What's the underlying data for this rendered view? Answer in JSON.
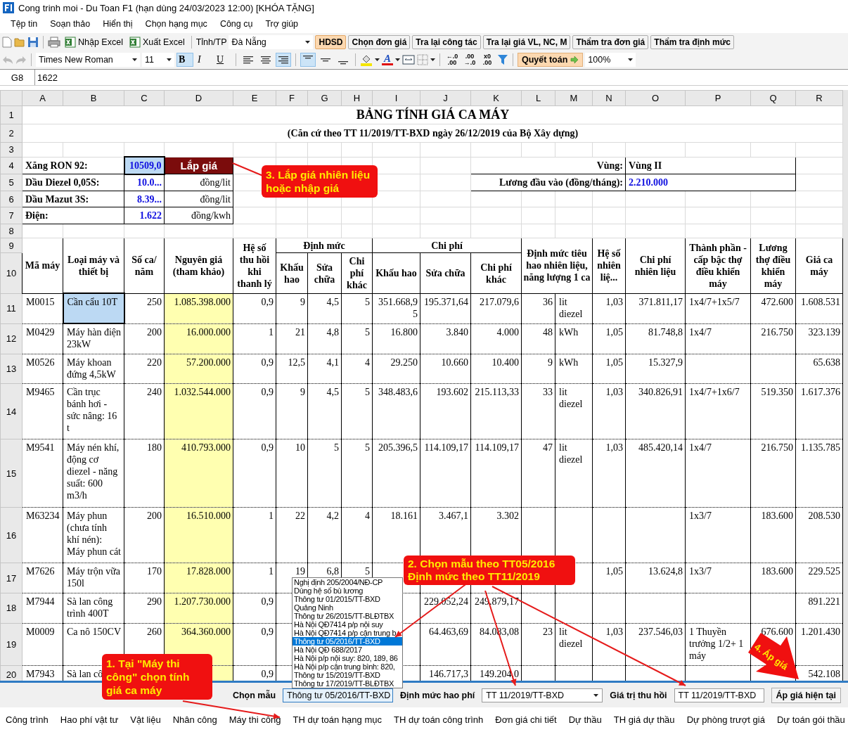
{
  "window": {
    "title": "Cong trinh moi - Du Toan F1  (hạn dùng 24/03/2023 12:00) [KHÓA TẶNG]"
  },
  "menu": [
    "Tệp tin",
    "Soạn thảo",
    "Hiển thị",
    "Chọn hạng mục",
    "Công cụ",
    "Trợ giúp"
  ],
  "toolbar": {
    "import_excel": "Nhập Excel",
    "export_excel": "Xuất Excel",
    "province_label": "Tỉnh/TP",
    "province": "Đà Nẵng",
    "buttons": [
      {
        "label": "HDSD",
        "highlighted": true
      },
      {
        "label": "Chọn đơn giá",
        "highlighted": false
      },
      {
        "label": "Tra lại công tác",
        "highlighted": false
      },
      {
        "label": "Tra lại giá VL, NC, M",
        "highlighted": false
      },
      {
        "label": "Thẩm tra đơn giá",
        "highlighted": false
      },
      {
        "label": "Thẩm tra định mức",
        "highlighted": false
      }
    ]
  },
  "format_bar": {
    "font": "Times New Roman",
    "size": "11",
    "styles": [
      {
        "glyph": "B",
        "selected": true
      },
      {
        "glyph": "I",
        "selected": false
      },
      {
        "glyph": "U",
        "selected": false
      }
    ],
    "halign": [
      {
        "kind": "left",
        "selected": false
      },
      {
        "kind": "center",
        "selected": false
      },
      {
        "kind": "right",
        "selected": true
      }
    ],
    "valign": [
      {
        "kind": "top",
        "selected": true
      },
      {
        "kind": "middle",
        "selected": false
      },
      {
        "kind": "bottom",
        "selected": false
      }
    ],
    "font_color_glyph": "A",
    "decimals": [
      {
        "top": "←.0",
        "bottom": ".00"
      },
      {
        "top": ".00",
        "bottom": "→.0"
      },
      {
        "top": "x0",
        "bottom": ".00"
      }
    ],
    "settle_button": "Quyết toán",
    "zoom": "100%"
  },
  "formula_bar": {
    "cell": "G8",
    "value": "1622"
  },
  "sheet": {
    "columns": [
      "A",
      "B",
      "C",
      "D",
      "E",
      "F",
      "G",
      "H",
      "I",
      "J",
      "K",
      "L",
      "M",
      "N",
      "O",
      "P",
      "Q",
      "R"
    ],
    "rows": [
      {
        "kind": "title",
        "number": "1",
        "text": "BẢNG TÍNH GIÁ CA MÁY"
      },
      {
        "kind": "subtitle",
        "number": "2",
        "text": "(Căn cứ theo TT 11/2019/TT-BXD ngày 26/12/2019 của Bộ Xây dựng)"
      },
      {
        "kind": "blank",
        "number": "3"
      },
      {
        "kind": "params",
        "number": "4",
        "label": "Xăng RON 92:",
        "value": {
          "text": "10509,0",
          "selected": true
        },
        "button": "Lắp giá",
        "right_label": "Vùng:",
        "right_value": {
          "text": "Vùng II",
          "kind": "text"
        }
      },
      {
        "kind": "params",
        "number": "5",
        "label": "Dầu Diezel 0,05S:",
        "value": {
          "text": "10.0...",
          "selected": false
        },
        "unit": "đồng/lit",
        "right_label": "Lương đầu vào (đồng/tháng):",
        "right_value": {
          "text": "2.210.000",
          "kind": "number"
        }
      },
      {
        "kind": "params",
        "number": "6",
        "label": "Dầu Mazut 3S:",
        "value": {
          "text": "8.39...",
          "selected": false
        },
        "unit": "đồng/lit"
      },
      {
        "kind": "params",
        "number": "7",
        "label": "Điện:",
        "value": {
          "text": "1.622",
          "selected": false
        },
        "unit": "đồng/kwh"
      },
      {
        "kind": "blank",
        "number": "8"
      },
      {
        "kind": "header",
        "numbers": [
          "9",
          "10"
        ],
        "columns": [
          {
            "text": "Mã máy"
          },
          {
            "text": "Loại máy và thiết bị"
          },
          {
            "text": "Số ca/ năm"
          },
          {
            "text": "Nguyên giá (tham khảo)"
          },
          {
            "text": "Hệ số thu hồi khi thanh lý"
          },
          {
            "text": "Định mức",
            "children": [
              "Khấu hao",
              "Sửa chữa",
              "Chi phí khác"
            ]
          },
          {
            "text": "Chi phí",
            "children": [
              "Khấu hao",
              "Sửa chữa",
              "Chi phí khác"
            ]
          },
          {
            "text": "Định mức tiêu hao nhiên liệu, năng lượng 1 ca",
            "wide": true
          },
          {
            "text": "Hệ số nhiên liệ..."
          },
          {
            "text": "Chi phí nhiên liệu"
          },
          {
            "text": "Thành phần - cấp bậc thợ điều khiển máy"
          },
          {
            "text": "Lương thợ điều khiển máy"
          },
          {
            "text": "Giá ca máy"
          }
        ]
      },
      {
        "kind": "data",
        "number": "11",
        "cells": [
          "M0015",
          {
            "text": "Cần cẩu 10T",
            "selected": true
          },
          "250",
          "1.085.398.000",
          "0,9",
          "9",
          "4,5",
          "5",
          "351.668,95",
          "195.371,64",
          "217.079,6",
          "36",
          "lit diezel",
          "1,03",
          "371.811,17",
          "1x4/7+1x5/7",
          "472.600",
          "1.608.531"
        ]
      },
      {
        "kind": "data",
        "number": "12",
        "cells": [
          "M0429",
          "Máy hàn điện 23kW",
          "200",
          "16.000.000",
          "1",
          "21",
          "4,8",
          "5",
          "16.800",
          "3.840",
          "4.000",
          "48",
          "kWh",
          "1,05",
          "81.748,8",
          "1x4/7",
          "216.750",
          "323.139"
        ]
      },
      {
        "kind": "data",
        "number": "13",
        "cells": [
          "M0526",
          "Máy khoan đứng 4,5kW",
          "220",
          "57.200.000",
          "0,9",
          "12,5",
          "4,1",
          "4",
          "29.250",
          "10.660",
          "10.400",
          "9",
          "kWh",
          "1,05",
          "15.327,9",
          null,
          null,
          "65.638"
        ]
      },
      {
        "kind": "data",
        "number": "14",
        "cells": [
          "M9465",
          "Cần trục bánh hơi - sức nâng: 16 t",
          "240",
          "1.032.544.000",
          "0,9",
          "9",
          "4,5",
          "5",
          "348.483,6",
          "193.602",
          "215.113,33",
          "33",
          "lit diezel",
          "1,03",
          "340.826,91",
          "1x4/7+1x6/7",
          "519.350",
          "1.617.376"
        ]
      },
      {
        "kind": "data",
        "number": "15",
        "cells": [
          "M9541",
          "Máy nén khí, động cơ diezel - năng suất: 600 m3/h",
          "180",
          "410.793.000",
          "0,9",
          "10",
          "5",
          "5",
          "205.396,5",
          "114.109,17",
          "114.109,17",
          "47",
          "lit diezel",
          "1,03",
          "485.420,14",
          "1x4/7",
          "216.750",
          "1.135.785"
        ]
      },
      {
        "kind": "data",
        "number": "16",
        "cells": [
          "M63234",
          "Máy phun (chưa tính khí nén): Máy phun cát",
          "200",
          "16.510.000",
          "1",
          "22",
          "4,2",
          "4",
          "18.161",
          "3.467,1",
          "3.302",
          null,
          null,
          null,
          null,
          "1x3/7",
          "183.600",
          "208.530"
        ]
      },
      {
        "kind": "data",
        "number": "17",
        "cells": [
          "M7626",
          "Máy trộn vữa 150l",
          "170",
          "17.828.000",
          "1",
          "19",
          "6,8",
          "5",
          null,
          null,
          null,
          null,
          null,
          "1,05",
          "13.624,8",
          "1x3/7",
          "183.600",
          "229.525"
        ]
      },
      {
        "kind": "data",
        "number": "18",
        "cells": [
          "M7944",
          "Sà lan công trình 400T",
          "290",
          "1.207.730.000",
          "0,9",
          null,
          null,
          null,
          null,
          "229.052,24",
          "249.879,17",
          null,
          null,
          null,
          null,
          null,
          null,
          "891.221"
        ]
      },
      {
        "kind": "data",
        "number": "19",
        "cells": [
          "M0009",
          "Ca nô 150CV",
          "260",
          "364.360.000",
          "0,9",
          null,
          null,
          null,
          null,
          "64.463,69",
          "84.083,08",
          "23",
          "lit diezel",
          "1,03",
          "237.546,03",
          "1 Thuyền trưởng 1/2+ 1 máy",
          "676.600",
          "1.201.430"
        ]
      },
      {
        "kind": "data",
        "number": "20",
        "cells": [
          "M7943",
          "Sà lan cô",
          null,
          null,
          "0,9",
          null,
          null,
          null,
          null,
          "146.717,3",
          "149.204,0",
          null,
          null,
          null,
          null,
          null,
          null,
          "542.108"
        ]
      }
    ]
  },
  "template_dropdown": [
    {
      "label": "Nghị định 205/2004/NĐ-CP",
      "selected": false
    },
    {
      "label": "Dùng hệ số bù lương",
      "selected": false
    },
    {
      "label": "Thông tư 01/2015/TT-BXD",
      "selected": false
    },
    {
      "label": "Quảng Ninh",
      "selected": false
    },
    {
      "label": "Thông tư 26/2015/TT-BLĐTBX",
      "selected": false
    },
    {
      "label": "Hà Nội QĐ7414 p/p nội suy",
      "selected": false
    },
    {
      "label": "Hà Nội QĐ7414 p/p cận trung b",
      "selected": false
    },
    {
      "label": "Thông tư 05/2016/TT-BXD",
      "selected": true
    },
    {
      "label": "Hà Nội QĐ 688/2017",
      "selected": false
    },
    {
      "label": "Hà Nội p/p nội suy: 820, 189, 86",
      "selected": false
    },
    {
      "label": "Hà Nội p/p cận trung bình: 820,",
      "selected": false
    },
    {
      "label": "Thông tư 15/2019/TT-BXD",
      "selected": false
    },
    {
      "label": "Thông tư 17/2019/TT-BLĐTBX",
      "selected": false
    }
  ],
  "bottom_panel": {
    "template_label": "Chọn mẫu",
    "template": "Thông tư 05/2016/TT-BXD",
    "norm_label": "Định mức hao phí",
    "norm": "TT 11/2019/TT-BXD",
    "salvage_label": "Giá trị thu hồi",
    "salvage": "TT 11/2019/TT-BXD",
    "apply_button": "Áp giá hiện tại"
  },
  "sheet_tabs": [
    "Công trình",
    "Hao phí vật tư",
    "Vật liệu",
    "Nhân công",
    "Máy thi công",
    "TH dự toán hạng mục",
    "TH dự toán công trình",
    "Đơn giá chi tiết",
    "Dự thầu",
    "TH giá dự thầu",
    "Dự phòng trượt giá",
    "Dự toán gói thầu"
  ],
  "callouts": {
    "fuel_price": [
      "3. Lắp giá nhiên liệu",
      "hoặc nhập giá"
    ],
    "template": [
      "2. Chọn mẫu theo TT05/2016",
      "Định mức theo TT11/2019"
    ],
    "machine_sheet": [
      "1. Tại \"Máy thi",
      "công\" chọn tính",
      "giá ca máy"
    ],
    "apply": "4. Áp giá"
  }
}
